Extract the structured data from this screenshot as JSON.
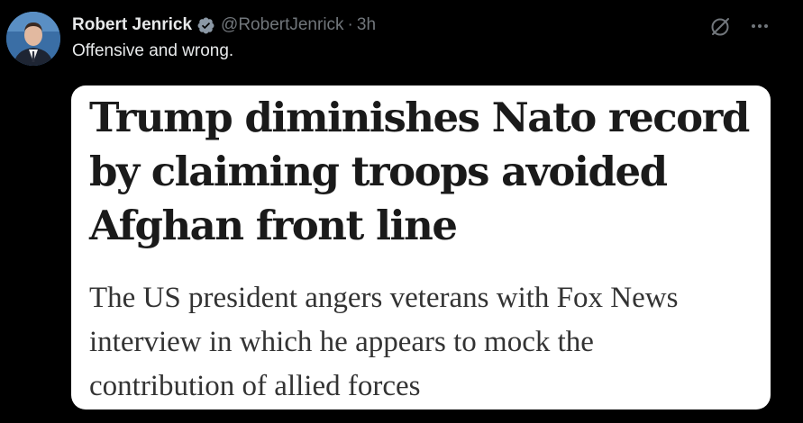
{
  "tweet": {
    "author_name": "Robert Jenrick",
    "handle": "@RobertJenrick",
    "separator": "·",
    "time": "3h",
    "text": "Offensive and wrong.",
    "verified_icon": "verified-badge-icon",
    "grok_icon": "grok-slash-icon",
    "more_icon": "more-dots-icon"
  },
  "media": {
    "headline_lines": [
      "Trump diminishes Nato record",
      "by claiming troops avoided",
      "Afghan front line"
    ],
    "standfirst_lines": [
      "The US president angers veterans with Fox News",
      "interview in which he appears to mock the",
      "contribution of allied forces"
    ]
  },
  "colors": {
    "background": "#000000",
    "text_primary": "#e7e9ea",
    "text_secondary": "#71767b",
    "card_background": "#ffffff",
    "verified_badge": "#8b98a5"
  }
}
